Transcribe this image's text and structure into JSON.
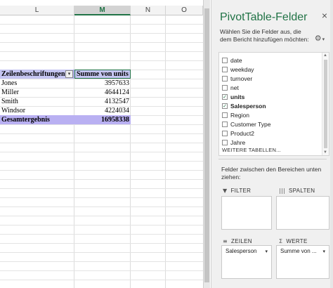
{
  "sheet": {
    "columns": [
      {
        "id": "L",
        "active": false
      },
      {
        "id": "M",
        "active": true
      },
      {
        "id": "N",
        "active": false
      },
      {
        "id": "O",
        "active": false
      }
    ]
  },
  "pivot": {
    "row_label_header": "Zeilenbeschriftungen",
    "filter_glyph": "▾",
    "value_header": "Summe von units",
    "rows": [
      {
        "label": "Jones",
        "value": "3957633"
      },
      {
        "label": "Miller",
        "value": "4644124"
      },
      {
        "label": "Smith",
        "value": "4132547"
      },
      {
        "label": "Windsor",
        "value": "4224034"
      }
    ],
    "total_label": "Gesamtergebnis",
    "total_value": "16958338"
  },
  "panel": {
    "title": "PivotTable-Felder",
    "close_glyph": "×",
    "description": "Wählen Sie die Felder aus, die dem Bericht hinzufügen möchten:",
    "gear_icon": "⚙",
    "gear_caret": "▾",
    "fields": [
      {
        "label": "date",
        "checked": false
      },
      {
        "label": "weekday",
        "checked": false
      },
      {
        "label": "turnover",
        "checked": false
      },
      {
        "label": "net",
        "checked": false
      },
      {
        "label": "units",
        "checked": true
      },
      {
        "label": "Salesperson",
        "checked": true
      },
      {
        "label": "Region",
        "checked": false
      },
      {
        "label": "Customer Type",
        "checked": false
      },
      {
        "label": "Product2",
        "checked": false
      },
      {
        "label": "Jahre",
        "checked": false
      }
    ],
    "check_glyph": "✓",
    "more_tables": "WEITERE TABELLEN...",
    "areas_description": "Felder zwischen den Bereichen unten ziehen:",
    "areas": {
      "filter": {
        "label": "FILTER",
        "icon": "▼"
      },
      "columns": {
        "label": "SPALTEN",
        "icon": "|||"
      },
      "rows": {
        "label": "ZEILEN",
        "icon": "≡",
        "chip": "Salesperson"
      },
      "values": {
        "label": "WERTE",
        "icon": "Σ",
        "chip": "Summe von ..."
      }
    },
    "chip_caret": "▾"
  },
  "colors": {
    "accent": "#217346",
    "pivot_header": "#c6c6f2",
    "pivot_total": "#b9b0f2"
  }
}
